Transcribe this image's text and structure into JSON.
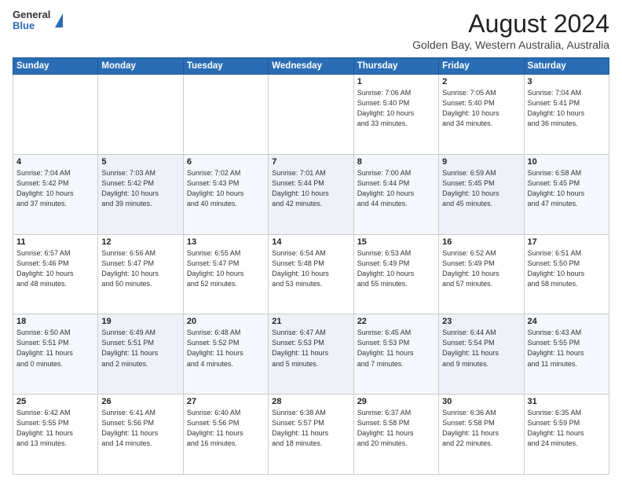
{
  "header": {
    "logo_general": "General",
    "logo_blue": "Blue",
    "month_year": "August 2024",
    "location": "Golden Bay, Western Australia, Australia"
  },
  "weekdays": [
    "Sunday",
    "Monday",
    "Tuesday",
    "Wednesday",
    "Thursday",
    "Friday",
    "Saturday"
  ],
  "weeks": [
    [
      {
        "day": "",
        "info": ""
      },
      {
        "day": "",
        "info": ""
      },
      {
        "day": "",
        "info": ""
      },
      {
        "day": "",
        "info": ""
      },
      {
        "day": "1",
        "info": "Sunrise: 7:06 AM\nSunset: 5:40 PM\nDaylight: 10 hours\nand 33 minutes."
      },
      {
        "day": "2",
        "info": "Sunrise: 7:05 AM\nSunset: 5:40 PM\nDaylight: 10 hours\nand 34 minutes."
      },
      {
        "day": "3",
        "info": "Sunrise: 7:04 AM\nSunset: 5:41 PM\nDaylight: 10 hours\nand 36 minutes."
      }
    ],
    [
      {
        "day": "4",
        "info": "Sunrise: 7:04 AM\nSunset: 5:42 PM\nDaylight: 10 hours\nand 37 minutes."
      },
      {
        "day": "5",
        "info": "Sunrise: 7:03 AM\nSunset: 5:42 PM\nDaylight: 10 hours\nand 39 minutes."
      },
      {
        "day": "6",
        "info": "Sunrise: 7:02 AM\nSunset: 5:43 PM\nDaylight: 10 hours\nand 40 minutes."
      },
      {
        "day": "7",
        "info": "Sunrise: 7:01 AM\nSunset: 5:44 PM\nDaylight: 10 hours\nand 42 minutes."
      },
      {
        "day": "8",
        "info": "Sunrise: 7:00 AM\nSunset: 5:44 PM\nDaylight: 10 hours\nand 44 minutes."
      },
      {
        "day": "9",
        "info": "Sunrise: 6:59 AM\nSunset: 5:45 PM\nDaylight: 10 hours\nand 45 minutes."
      },
      {
        "day": "10",
        "info": "Sunrise: 6:58 AM\nSunset: 5:45 PM\nDaylight: 10 hours\nand 47 minutes."
      }
    ],
    [
      {
        "day": "11",
        "info": "Sunrise: 6:57 AM\nSunset: 5:46 PM\nDaylight: 10 hours\nand 48 minutes."
      },
      {
        "day": "12",
        "info": "Sunrise: 6:56 AM\nSunset: 5:47 PM\nDaylight: 10 hours\nand 50 minutes."
      },
      {
        "day": "13",
        "info": "Sunrise: 6:55 AM\nSunset: 5:47 PM\nDaylight: 10 hours\nand 52 minutes."
      },
      {
        "day": "14",
        "info": "Sunrise: 6:54 AM\nSunset: 5:48 PM\nDaylight: 10 hours\nand 53 minutes."
      },
      {
        "day": "15",
        "info": "Sunrise: 6:53 AM\nSunset: 5:49 PM\nDaylight: 10 hours\nand 55 minutes."
      },
      {
        "day": "16",
        "info": "Sunrise: 6:52 AM\nSunset: 5:49 PM\nDaylight: 10 hours\nand 57 minutes."
      },
      {
        "day": "17",
        "info": "Sunrise: 6:51 AM\nSunset: 5:50 PM\nDaylight: 10 hours\nand 58 minutes."
      }
    ],
    [
      {
        "day": "18",
        "info": "Sunrise: 6:50 AM\nSunset: 5:51 PM\nDaylight: 11 hours\nand 0 minutes."
      },
      {
        "day": "19",
        "info": "Sunrise: 6:49 AM\nSunset: 5:51 PM\nDaylight: 11 hours\nand 2 minutes."
      },
      {
        "day": "20",
        "info": "Sunrise: 6:48 AM\nSunset: 5:52 PM\nDaylight: 11 hours\nand 4 minutes."
      },
      {
        "day": "21",
        "info": "Sunrise: 6:47 AM\nSunset: 5:53 PM\nDaylight: 11 hours\nand 5 minutes."
      },
      {
        "day": "22",
        "info": "Sunrise: 6:45 AM\nSunset: 5:53 PM\nDaylight: 11 hours\nand 7 minutes."
      },
      {
        "day": "23",
        "info": "Sunrise: 6:44 AM\nSunset: 5:54 PM\nDaylight: 11 hours\nand 9 minutes."
      },
      {
        "day": "24",
        "info": "Sunrise: 6:43 AM\nSunset: 5:55 PM\nDaylight: 11 hours\nand 11 minutes."
      }
    ],
    [
      {
        "day": "25",
        "info": "Sunrise: 6:42 AM\nSunset: 5:55 PM\nDaylight: 11 hours\nand 13 minutes."
      },
      {
        "day": "26",
        "info": "Sunrise: 6:41 AM\nSunset: 5:56 PM\nDaylight: 11 hours\nand 14 minutes."
      },
      {
        "day": "27",
        "info": "Sunrise: 6:40 AM\nSunset: 5:56 PM\nDaylight: 11 hours\nand 16 minutes."
      },
      {
        "day": "28",
        "info": "Sunrise: 6:38 AM\nSunset: 5:57 PM\nDaylight: 11 hours\nand 18 minutes."
      },
      {
        "day": "29",
        "info": "Sunrise: 6:37 AM\nSunset: 5:58 PM\nDaylight: 11 hours\nand 20 minutes."
      },
      {
        "day": "30",
        "info": "Sunrise: 6:36 AM\nSunset: 5:58 PM\nDaylight: 11 hours\nand 22 minutes."
      },
      {
        "day": "31",
        "info": "Sunrise: 6:35 AM\nSunset: 5:59 PM\nDaylight: 11 hours\nand 24 minutes."
      }
    ]
  ]
}
